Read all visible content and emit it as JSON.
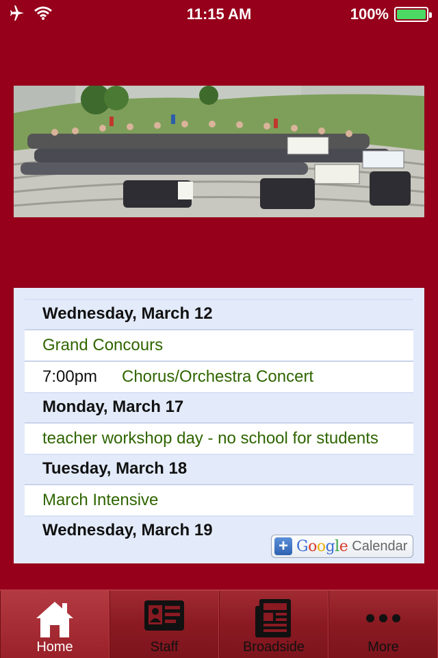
{
  "status_bar": {
    "time": "11:15 AM",
    "battery_text": "100%",
    "battery_level": 1.0,
    "icons": [
      "airplane-icon",
      "wifi-icon",
      "battery-icon"
    ]
  },
  "calendar": {
    "entries": [
      {
        "type": "day",
        "label": "Wednesday, March 12"
      },
      {
        "type": "event",
        "time": "",
        "title": "Grand Concours"
      },
      {
        "type": "event",
        "time": "7:00pm",
        "title": "Chorus/Orchestra Concert"
      },
      {
        "type": "day",
        "label": "Monday, March 17"
      },
      {
        "type": "event",
        "time": "",
        "title": "teacher workshop day - no school for students"
      },
      {
        "type": "day",
        "label": "Tuesday, March 18"
      },
      {
        "type": "event",
        "time": "",
        "title": "March Intensive"
      },
      {
        "type": "day",
        "label": "Wednesday, March 19"
      }
    ],
    "google_button": {
      "brand": "Google",
      "label": "Calendar"
    }
  },
  "tab_bar": {
    "tabs": [
      {
        "label": "Home",
        "icon": "home-icon",
        "active": true
      },
      {
        "label": "Staff",
        "icon": "id-card-icon",
        "active": false
      },
      {
        "label": "Broadside",
        "icon": "newspaper-icon",
        "active": false
      },
      {
        "label": "More",
        "icon": "more-dots-icon",
        "active": false
      }
    ]
  },
  "colors": {
    "background": "#96001b",
    "calendar_bg": "#e3ebfb",
    "event_title": "#2f6500",
    "battery": "#4cd964"
  }
}
